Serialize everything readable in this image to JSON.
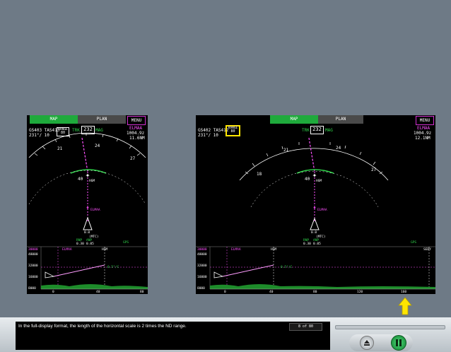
{
  "left_display": {
    "tabs": {
      "map": "MAP",
      "plan": "PLAN",
      "menu": "MENU"
    },
    "gs_tas": "GS403 TAS413",
    "wind": "231°/ 10",
    "range_label": "RANGE",
    "range_value": "80",
    "trk_label": "TRK",
    "heading": "232",
    "mag_label": "MAG",
    "wpt_name": "ELMAA",
    "wpt_time": "1004.9z",
    "wpt_dist": "11.6NM",
    "compass": [
      "21",
      "24",
      "27"
    ],
    "range_ring": "40",
    "wpt_plan": "HGM",
    "wpt_a": "ELMAA",
    "dist_bottom": "0.0",
    "mtc_label": "(MTC)",
    "rnp_label": "RNP",
    "anp_label": "ANP",
    "rnp_value": "0.30",
    "anp_value": "0.05",
    "gps_label": "GPS",
    "vsd": {
      "alt_top": "30000",
      "alt_mid": "48000",
      "alt_2": "32000",
      "alt_3": "16000",
      "alt_bottom": "8000",
      "wpt_a": "ELMAA",
      "wpt_b": "HGM",
      "path_label": "0.5°/C",
      "ticks": [
        "0",
        "40",
        "80"
      ]
    }
  },
  "right_display": {
    "tabs": {
      "map": "MAP",
      "plan": "PLAN",
      "menu": "MENU"
    },
    "gs_tas": "GS402 TAS412",
    "wind": "231°/ 10",
    "range_label": "RANGE",
    "range_value": "80",
    "trk_label": "TRK",
    "heading": "232",
    "mag_label": "MAG",
    "wpt_name": "ELMAA",
    "wpt_time": "1004.9z",
    "wpt_dist": "12.1NM",
    "compass": [
      "18",
      "21",
      "24",
      "27"
    ],
    "range_ring": "40",
    "wpt_plan": "HGM",
    "wpt_a": "ELMAA",
    "dist_bottom": "0.0",
    "mtc_label": "(MTC)",
    "rnp_label": "RNP",
    "anp_label": "ANP",
    "rnp_value": "0.30",
    "anp_value": "0.05",
    "gps_label": "GPS",
    "vsd": {
      "alt_top": "30000",
      "alt_mid": "48000",
      "alt_2": "32000",
      "alt_3": "16000",
      "alt_bottom": "8000",
      "wpt_a": "ELMAA",
      "wpt_b": "HGM",
      "wpt_c": "SEDY",
      "path_label": "0.5°/C",
      "ticks": [
        "0",
        "40",
        "80",
        "120",
        "160"
      ]
    }
  },
  "caption": "In the full-display format, the length of the horizontal scale is 2 times the ND range.",
  "page_counter": "8 of 80",
  "colors": {
    "accent": "#1faa3c",
    "magenta": "#ff50ff",
    "highlight": "#ffe600"
  },
  "icons": {
    "back": "eject-icon",
    "play": "pause-icon",
    "pointer": "up-arrow-icon"
  }
}
